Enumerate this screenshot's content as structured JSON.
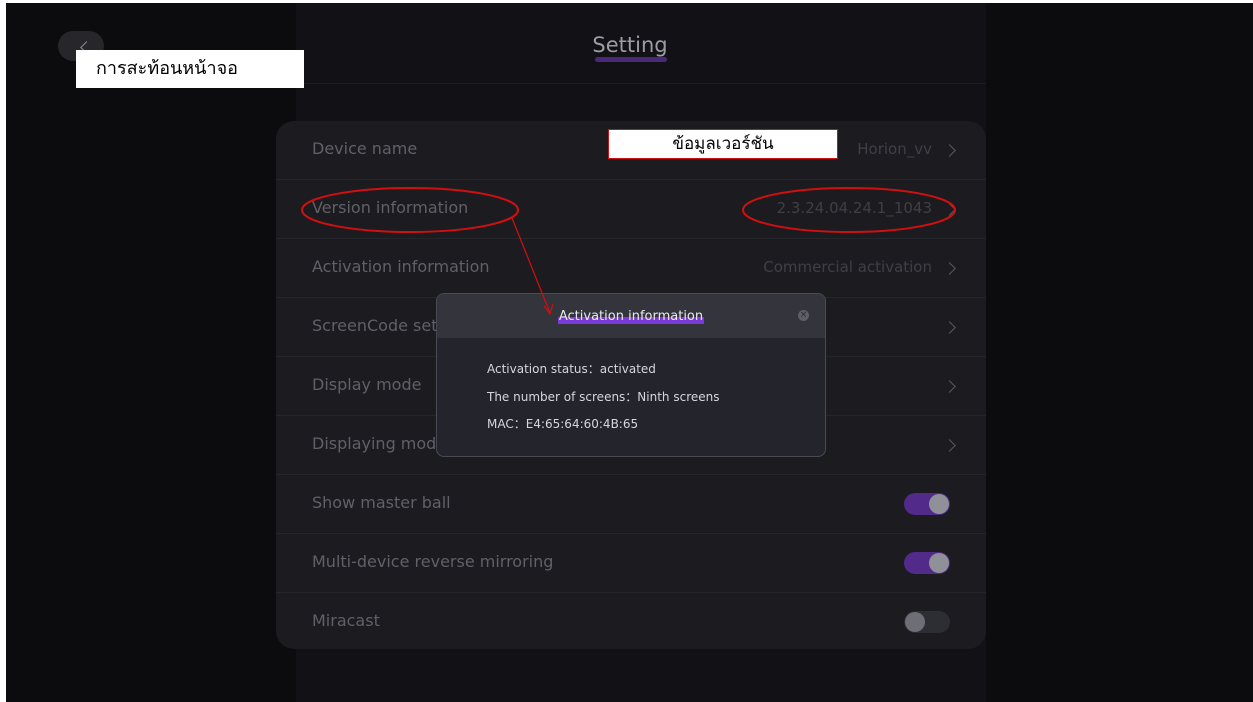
{
  "header": {
    "title": "Setting"
  },
  "settings": {
    "rows": [
      {
        "label": "Device name",
        "value": "Horion_vv"
      },
      {
        "label": "Version information",
        "value": "2.3.24.04.24.1_1043"
      },
      {
        "label": "Activation information",
        "value": "Commercial activation"
      },
      {
        "label": "ScreenCode set",
        "value": ""
      },
      {
        "label": "Display mode",
        "value": ""
      },
      {
        "label": "Displaying mod",
        "value": ""
      },
      {
        "label": "Show master ball",
        "toggle": "on"
      },
      {
        "label": "Multi-device reverse mirroring",
        "toggle": "on"
      },
      {
        "label": "Miracast",
        "toggle": "off"
      }
    ]
  },
  "dialog": {
    "title": "Activation information",
    "lines": [
      "Activation status：activated",
      "The number of screens：Ninth screens",
      "MAC：E4:65:64:60:4B:65"
    ]
  },
  "annotations": {
    "top_left": "การสะท้อนหน้าจอ",
    "version": "ข้อมูลเวอร์ชัน"
  },
  "colors": {
    "accent": "#512a8a",
    "annotation_red": "#d01010",
    "background": "#0c0c0f"
  }
}
